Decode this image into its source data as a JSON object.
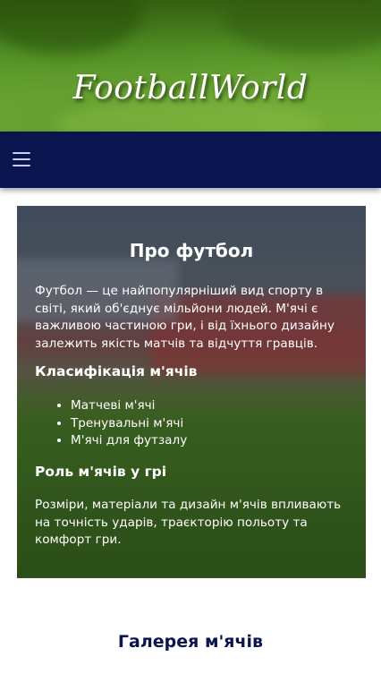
{
  "header": {
    "logo_text": "FootballWorld"
  },
  "nav": {
    "menu_icon": "hamburger-menu-icon"
  },
  "about": {
    "title": "Про футбол",
    "intro": "Футбол — це найпопулярніший вид спорту в світі, який об'єднує мільйони людей. М'ячі є важливою частиною гри, і від їхнього дизайну залежить якість матчів та відчуття гравців.",
    "classification_title": "Класифікація м'ячів",
    "classification_items": [
      "Матчеві м'ячі",
      "Тренувальні м'ячі",
      "М'ячі для футзалу"
    ],
    "role_title": "Роль м'ячів у грі",
    "role_text": "Розміри, матеріали та дизайн м'ячів впливають на точність ударів, траєкторію польоту та комфорт гри."
  },
  "gallery": {
    "title": "Галерея м'ячів"
  },
  "colors": {
    "nav_background": "#0a1550",
    "gallery_title": "#0a1550",
    "hero_green": "#4c8a22"
  }
}
